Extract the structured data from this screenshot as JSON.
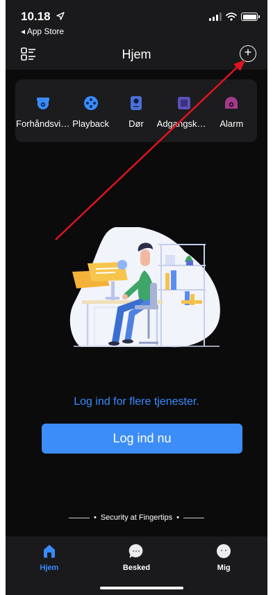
{
  "status_bar": {
    "time": "10.18",
    "back_label": "◂ App Store"
  },
  "header": {
    "title": "Hjem"
  },
  "services": [
    {
      "label": "Forhåndsvisning",
      "icon": "camera-icon",
      "color": "#3a8bff"
    },
    {
      "label": "Playback",
      "icon": "playback-icon",
      "color": "#3a8bff"
    },
    {
      "label": "Dør",
      "icon": "door-intercom-icon",
      "color": "#4a6fd6"
    },
    {
      "label": "Adgangskontrol",
      "icon": "access-control-icon",
      "color": "#5a52b5"
    },
    {
      "label": "Alarm",
      "icon": "alarm-icon",
      "color": "#a33b8a"
    }
  ],
  "main": {
    "login_prompt": "Log ind for flere tjenester.",
    "login_button": "Log ind nu",
    "tagline": "Security at Fingertips"
  },
  "tabbar": [
    {
      "label": "Hjem",
      "icon": "home-icon",
      "active": true
    },
    {
      "label": "Besked",
      "icon": "message-icon",
      "active": false
    },
    {
      "label": "Mig",
      "icon": "profile-icon",
      "active": false
    }
  ],
  "colors": {
    "accent": "#3a8bff",
    "annotation_arrow": "#e0141e"
  }
}
